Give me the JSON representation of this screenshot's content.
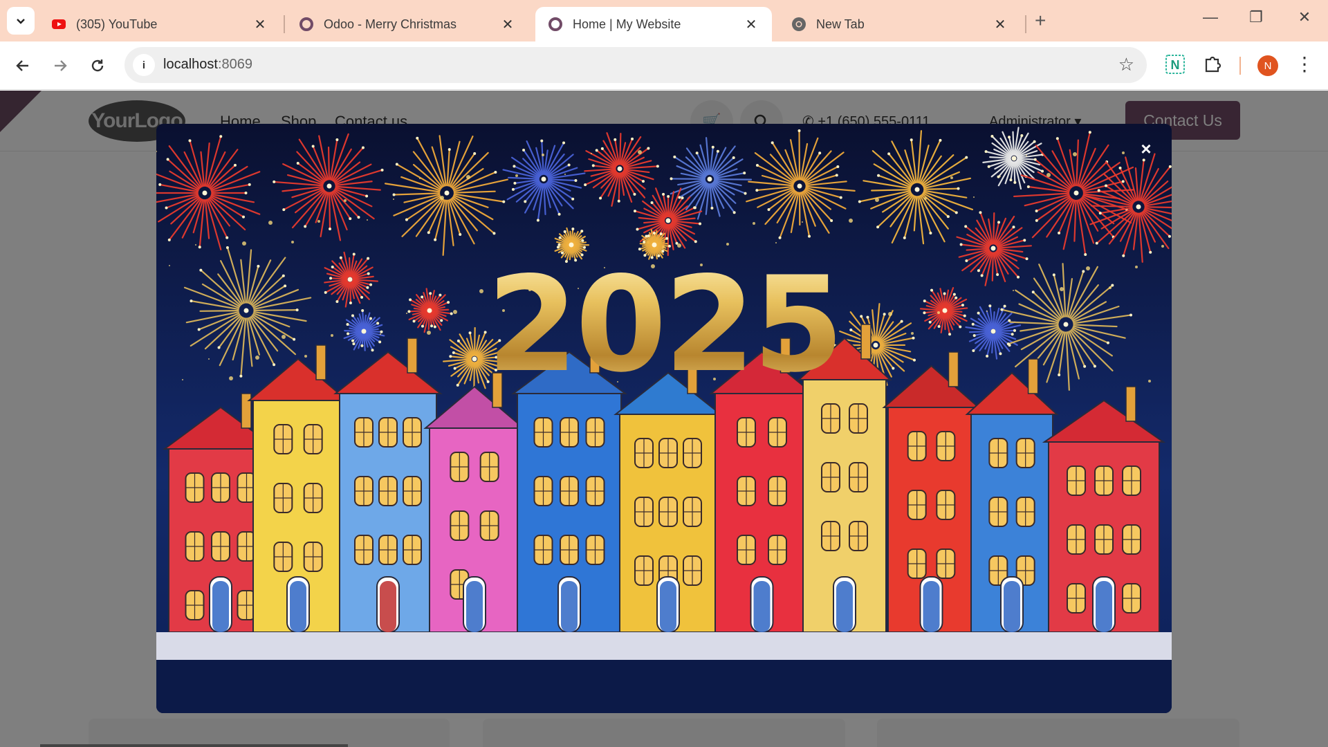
{
  "browser": {
    "tabs": [
      {
        "title": "(305) YouTube",
        "icon": "youtube-icon"
      },
      {
        "title": "Odoo - Merry Christmas",
        "icon": "odoo-icon"
      },
      {
        "title": "Home | My Website",
        "icon": "odoo-icon",
        "active": true
      },
      {
        "title": "New Tab",
        "icon": "chrome-icon"
      }
    ],
    "url_host": "localhost",
    "url_port": ":8069",
    "profile_initial": "N",
    "extension_badge": "N"
  },
  "site": {
    "logo_text": "YourLogo",
    "nav": [
      "Home",
      "Shop",
      "Contact us"
    ],
    "phone": "+1 (650) 555-0111",
    "user": "Administrator",
    "cta": "Contact Us"
  },
  "popup": {
    "year_text": "2025",
    "close_glyph": "×"
  },
  "colors": {
    "accent": "#714b67",
    "tabstrip": "#fbd8c6",
    "night_sky": "#0b1a44"
  }
}
